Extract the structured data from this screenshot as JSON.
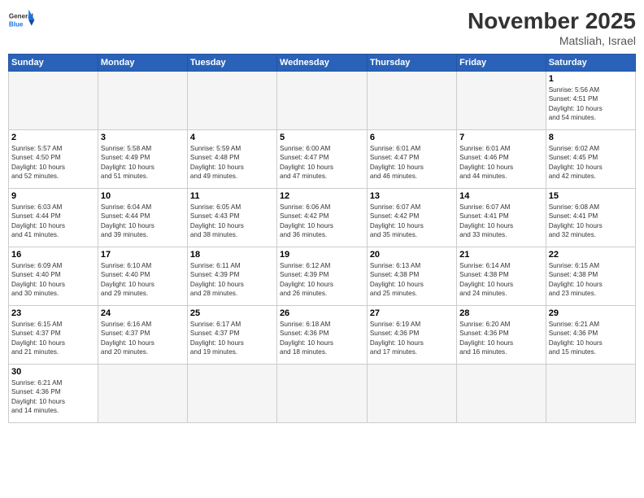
{
  "header": {
    "logo_general": "General",
    "logo_blue": "Blue",
    "month": "November 2025",
    "location": "Matsliah, Israel"
  },
  "weekdays": [
    "Sunday",
    "Monday",
    "Tuesday",
    "Wednesday",
    "Thursday",
    "Friday",
    "Saturday"
  ],
  "weeks": [
    [
      {
        "day": "",
        "info": ""
      },
      {
        "day": "",
        "info": ""
      },
      {
        "day": "",
        "info": ""
      },
      {
        "day": "",
        "info": ""
      },
      {
        "day": "",
        "info": ""
      },
      {
        "day": "",
        "info": ""
      },
      {
        "day": "1",
        "info": "Sunrise: 5:56 AM\nSunset: 4:51 PM\nDaylight: 10 hours\nand 54 minutes."
      }
    ],
    [
      {
        "day": "2",
        "info": "Sunrise: 5:57 AM\nSunset: 4:50 PM\nDaylight: 10 hours\nand 52 minutes."
      },
      {
        "day": "3",
        "info": "Sunrise: 5:58 AM\nSunset: 4:49 PM\nDaylight: 10 hours\nand 51 minutes."
      },
      {
        "day": "4",
        "info": "Sunrise: 5:59 AM\nSunset: 4:48 PM\nDaylight: 10 hours\nand 49 minutes."
      },
      {
        "day": "5",
        "info": "Sunrise: 6:00 AM\nSunset: 4:47 PM\nDaylight: 10 hours\nand 47 minutes."
      },
      {
        "day": "6",
        "info": "Sunrise: 6:01 AM\nSunset: 4:47 PM\nDaylight: 10 hours\nand 46 minutes."
      },
      {
        "day": "7",
        "info": "Sunrise: 6:01 AM\nSunset: 4:46 PM\nDaylight: 10 hours\nand 44 minutes."
      },
      {
        "day": "8",
        "info": "Sunrise: 6:02 AM\nSunset: 4:45 PM\nDaylight: 10 hours\nand 42 minutes."
      }
    ],
    [
      {
        "day": "9",
        "info": "Sunrise: 6:03 AM\nSunset: 4:44 PM\nDaylight: 10 hours\nand 41 minutes."
      },
      {
        "day": "10",
        "info": "Sunrise: 6:04 AM\nSunset: 4:44 PM\nDaylight: 10 hours\nand 39 minutes."
      },
      {
        "day": "11",
        "info": "Sunrise: 6:05 AM\nSunset: 4:43 PM\nDaylight: 10 hours\nand 38 minutes."
      },
      {
        "day": "12",
        "info": "Sunrise: 6:06 AM\nSunset: 4:42 PM\nDaylight: 10 hours\nand 36 minutes."
      },
      {
        "day": "13",
        "info": "Sunrise: 6:07 AM\nSunset: 4:42 PM\nDaylight: 10 hours\nand 35 minutes."
      },
      {
        "day": "14",
        "info": "Sunrise: 6:07 AM\nSunset: 4:41 PM\nDaylight: 10 hours\nand 33 minutes."
      },
      {
        "day": "15",
        "info": "Sunrise: 6:08 AM\nSunset: 4:41 PM\nDaylight: 10 hours\nand 32 minutes."
      }
    ],
    [
      {
        "day": "16",
        "info": "Sunrise: 6:09 AM\nSunset: 4:40 PM\nDaylight: 10 hours\nand 30 minutes."
      },
      {
        "day": "17",
        "info": "Sunrise: 6:10 AM\nSunset: 4:40 PM\nDaylight: 10 hours\nand 29 minutes."
      },
      {
        "day": "18",
        "info": "Sunrise: 6:11 AM\nSunset: 4:39 PM\nDaylight: 10 hours\nand 28 minutes."
      },
      {
        "day": "19",
        "info": "Sunrise: 6:12 AM\nSunset: 4:39 PM\nDaylight: 10 hours\nand 26 minutes."
      },
      {
        "day": "20",
        "info": "Sunrise: 6:13 AM\nSunset: 4:38 PM\nDaylight: 10 hours\nand 25 minutes."
      },
      {
        "day": "21",
        "info": "Sunrise: 6:14 AM\nSunset: 4:38 PM\nDaylight: 10 hours\nand 24 minutes."
      },
      {
        "day": "22",
        "info": "Sunrise: 6:15 AM\nSunset: 4:38 PM\nDaylight: 10 hours\nand 23 minutes."
      }
    ],
    [
      {
        "day": "23",
        "info": "Sunrise: 6:15 AM\nSunset: 4:37 PM\nDaylight: 10 hours\nand 21 minutes."
      },
      {
        "day": "24",
        "info": "Sunrise: 6:16 AM\nSunset: 4:37 PM\nDaylight: 10 hours\nand 20 minutes."
      },
      {
        "day": "25",
        "info": "Sunrise: 6:17 AM\nSunset: 4:37 PM\nDaylight: 10 hours\nand 19 minutes."
      },
      {
        "day": "26",
        "info": "Sunrise: 6:18 AM\nSunset: 4:36 PM\nDaylight: 10 hours\nand 18 minutes."
      },
      {
        "day": "27",
        "info": "Sunrise: 6:19 AM\nSunset: 4:36 PM\nDaylight: 10 hours\nand 17 minutes."
      },
      {
        "day": "28",
        "info": "Sunrise: 6:20 AM\nSunset: 4:36 PM\nDaylight: 10 hours\nand 16 minutes."
      },
      {
        "day": "29",
        "info": "Sunrise: 6:21 AM\nSunset: 4:36 PM\nDaylight: 10 hours\nand 15 minutes."
      }
    ],
    [
      {
        "day": "30",
        "info": "Sunrise: 6:21 AM\nSunset: 4:36 PM\nDaylight: 10 hours\nand 14 minutes."
      },
      {
        "day": "",
        "info": ""
      },
      {
        "day": "",
        "info": ""
      },
      {
        "day": "",
        "info": ""
      },
      {
        "day": "",
        "info": ""
      },
      {
        "day": "",
        "info": ""
      },
      {
        "day": "",
        "info": ""
      }
    ]
  ]
}
